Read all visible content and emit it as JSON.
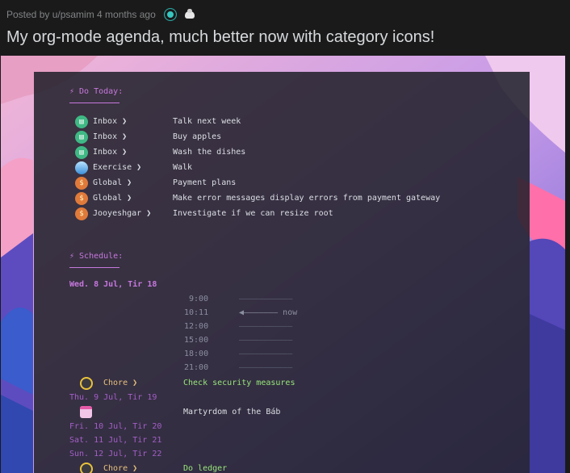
{
  "post": {
    "meta": "Posted by u/psamim 4 months ago",
    "title": "My org-mode agenda, much better now with category icons!"
  },
  "agenda": {
    "do_today": {
      "heading": "⚡ Do Today:",
      "items": [
        {
          "icon": "inbox-icon",
          "category": "Inbox ❯",
          "task": "Talk next week"
        },
        {
          "icon": "inbox-icon",
          "category": "Inbox ❯",
          "task": "Buy apples"
        },
        {
          "icon": "inbox-icon",
          "category": "Inbox ❯",
          "task": "Wash the dishes"
        },
        {
          "icon": "exercise-icon",
          "category": "Exercise ❯",
          "task": "Walk"
        },
        {
          "icon": "money-bag-icon",
          "category": "Global ❯",
          "task": "Payment plans"
        },
        {
          "icon": "money-bag-icon",
          "category": "Global ❯",
          "task": "Make error messages display errors from payment gateway"
        },
        {
          "icon": "money-bag-icon",
          "category": "Jooyeshgar ❯",
          "task": "Investigate if we can resize root"
        }
      ]
    },
    "schedule": {
      "heading": "⚡ Schedule:",
      "today": "Wed.  8 Jul, Tir 18",
      "times": [
        "9:00",
        "10:11",
        "12:00",
        "15:00",
        "18:00",
        "21:00"
      ],
      "grid_line": "———————————",
      "now_marker": "◀——————— now",
      "chore1": {
        "category": "Chore ❯",
        "task": "Check security measures"
      },
      "thu": "Thu.  9 Jul, Tir 19",
      "holiday": "Martyrdom of the Báb",
      "fri": "Fri. 10 Jul, Tir 20",
      "sat": "Sat. 11 Jul, Tir 21",
      "sun": "Sun. 12 Jul, Tir 22",
      "chore2": {
        "category": "Chore ❯",
        "task": "Do ledger"
      }
    }
  }
}
